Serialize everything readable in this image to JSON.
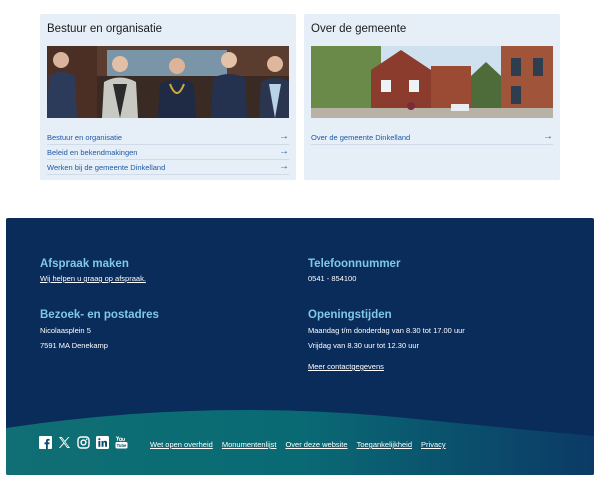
{
  "cards": {
    "left": {
      "title": "Bestuur en organisatie",
      "links": [
        {
          "label": "Bestuur en organisatie"
        },
        {
          "label": "Beleid en bekendmakingen"
        },
        {
          "label": "Werken bij de gemeente Dinkelland"
        }
      ]
    },
    "right": {
      "title": "Over de gemeente",
      "links": [
        {
          "label": "Over de gemeente Dinkelland"
        }
      ]
    },
    "arrow": "→"
  },
  "footer": {
    "appointment": {
      "heading": "Afspraak maken",
      "link": "Wij helpen u graag op afspraak."
    },
    "phone": {
      "heading": "Telefoonnummer",
      "number": "0541 - 854100"
    },
    "address": {
      "heading": "Bezoek- en postadres",
      "line1": "Nicolaasplein 5",
      "line2": "7591 MA Denekamp"
    },
    "hours": {
      "heading": "Openingstijden",
      "line1": "Maandag t/m donderdag van 8.30 tot 17.00 uur",
      "line2": "Vrijdag van 8.30 uur tot 12.30 uur",
      "link": "Meer contactgegevens"
    },
    "social": [
      "facebook-icon",
      "x-icon",
      "instagram-icon",
      "linkedin-icon",
      "youtube-icon"
    ],
    "bottom_links": [
      "Wet open overheid",
      "Monumentenlijst",
      "Over deze website",
      "Toegankelijkheid",
      "Privacy"
    ]
  },
  "colors": {
    "card_bg": "#e6eef7",
    "link": "#1f5aa6",
    "footer_bg": "#0a2c5b",
    "heading_accent": "#7fc9e8"
  }
}
